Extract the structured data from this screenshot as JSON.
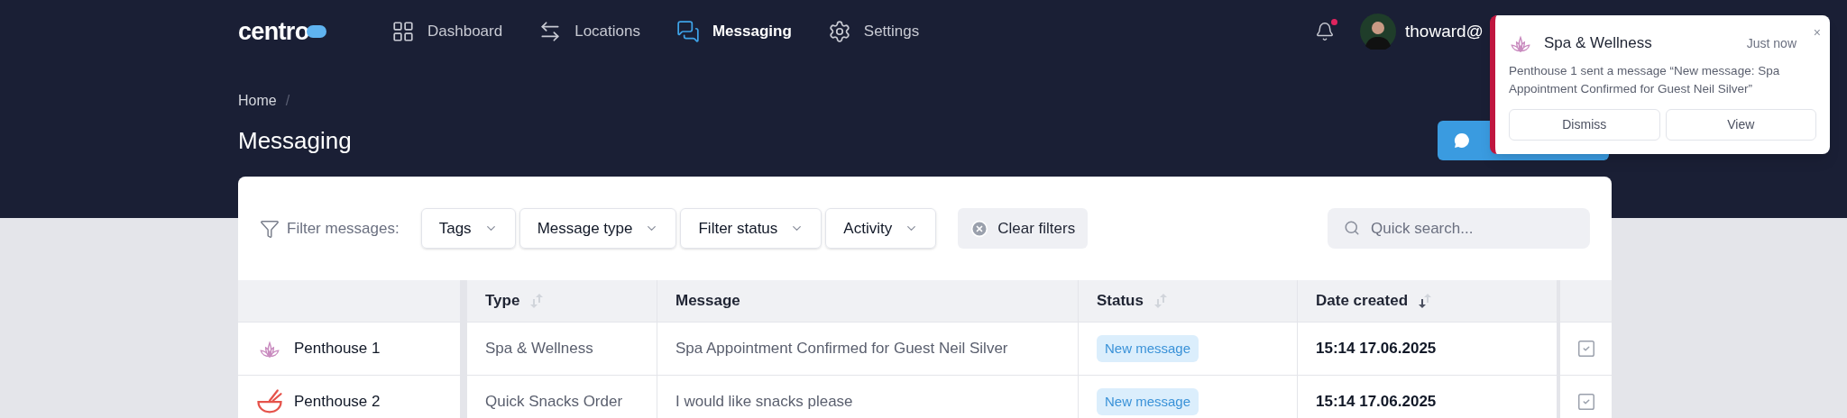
{
  "logo": "centro",
  "nav": [
    {
      "label": "Dashboard",
      "selected": false
    },
    {
      "label": "Locations",
      "selected": false
    },
    {
      "label": "Messaging",
      "selected": true
    },
    {
      "label": "Settings",
      "selected": false
    }
  ],
  "user": {
    "name": "thoward@",
    "unread": true
  },
  "breadcrumb": [
    "Home"
  ],
  "breadcrumb_separator": "/",
  "page_title": "Messaging",
  "notification": {
    "title": "Spa & Wellness",
    "time": "Just now",
    "body": "Penthouse 1 sent a message “New message: Spa Appointment Confirmed for Guest Neil Silver”",
    "close": "×",
    "buttons": [
      "Dismiss",
      "View"
    ]
  },
  "filters": {
    "label": "Filter messages:",
    "dropdowns": [
      "Tags",
      "Message type",
      "Filter status",
      "Activity"
    ],
    "clear": "Clear filters",
    "search_placeholder": "Quick search..."
  },
  "table": {
    "columns": [
      {},
      {
        "label": "Type",
        "sortable": true,
        "sorted": false
      },
      {
        "label": "Message"
      },
      {
        "label": "Status",
        "sortable": true,
        "sorted": false
      },
      {
        "label": "Date created",
        "sortable": true,
        "sorted": true
      },
      {}
    ],
    "rows": [
      {
        "kind": "spa",
        "location": "Penthouse 1",
        "type": "Spa & Wellness",
        "message": "Spa Appointment Confirmed for Guest Neil Silver",
        "status": "New message",
        "date": "15:14 17.06.2025"
      },
      {
        "kind": "food",
        "location": "Penthouse 2",
        "type": "Quick Snacks Order",
        "message": "I would like snacks please",
        "status": "New message",
        "date": "15:14 17.06.2025"
      }
    ]
  }
}
